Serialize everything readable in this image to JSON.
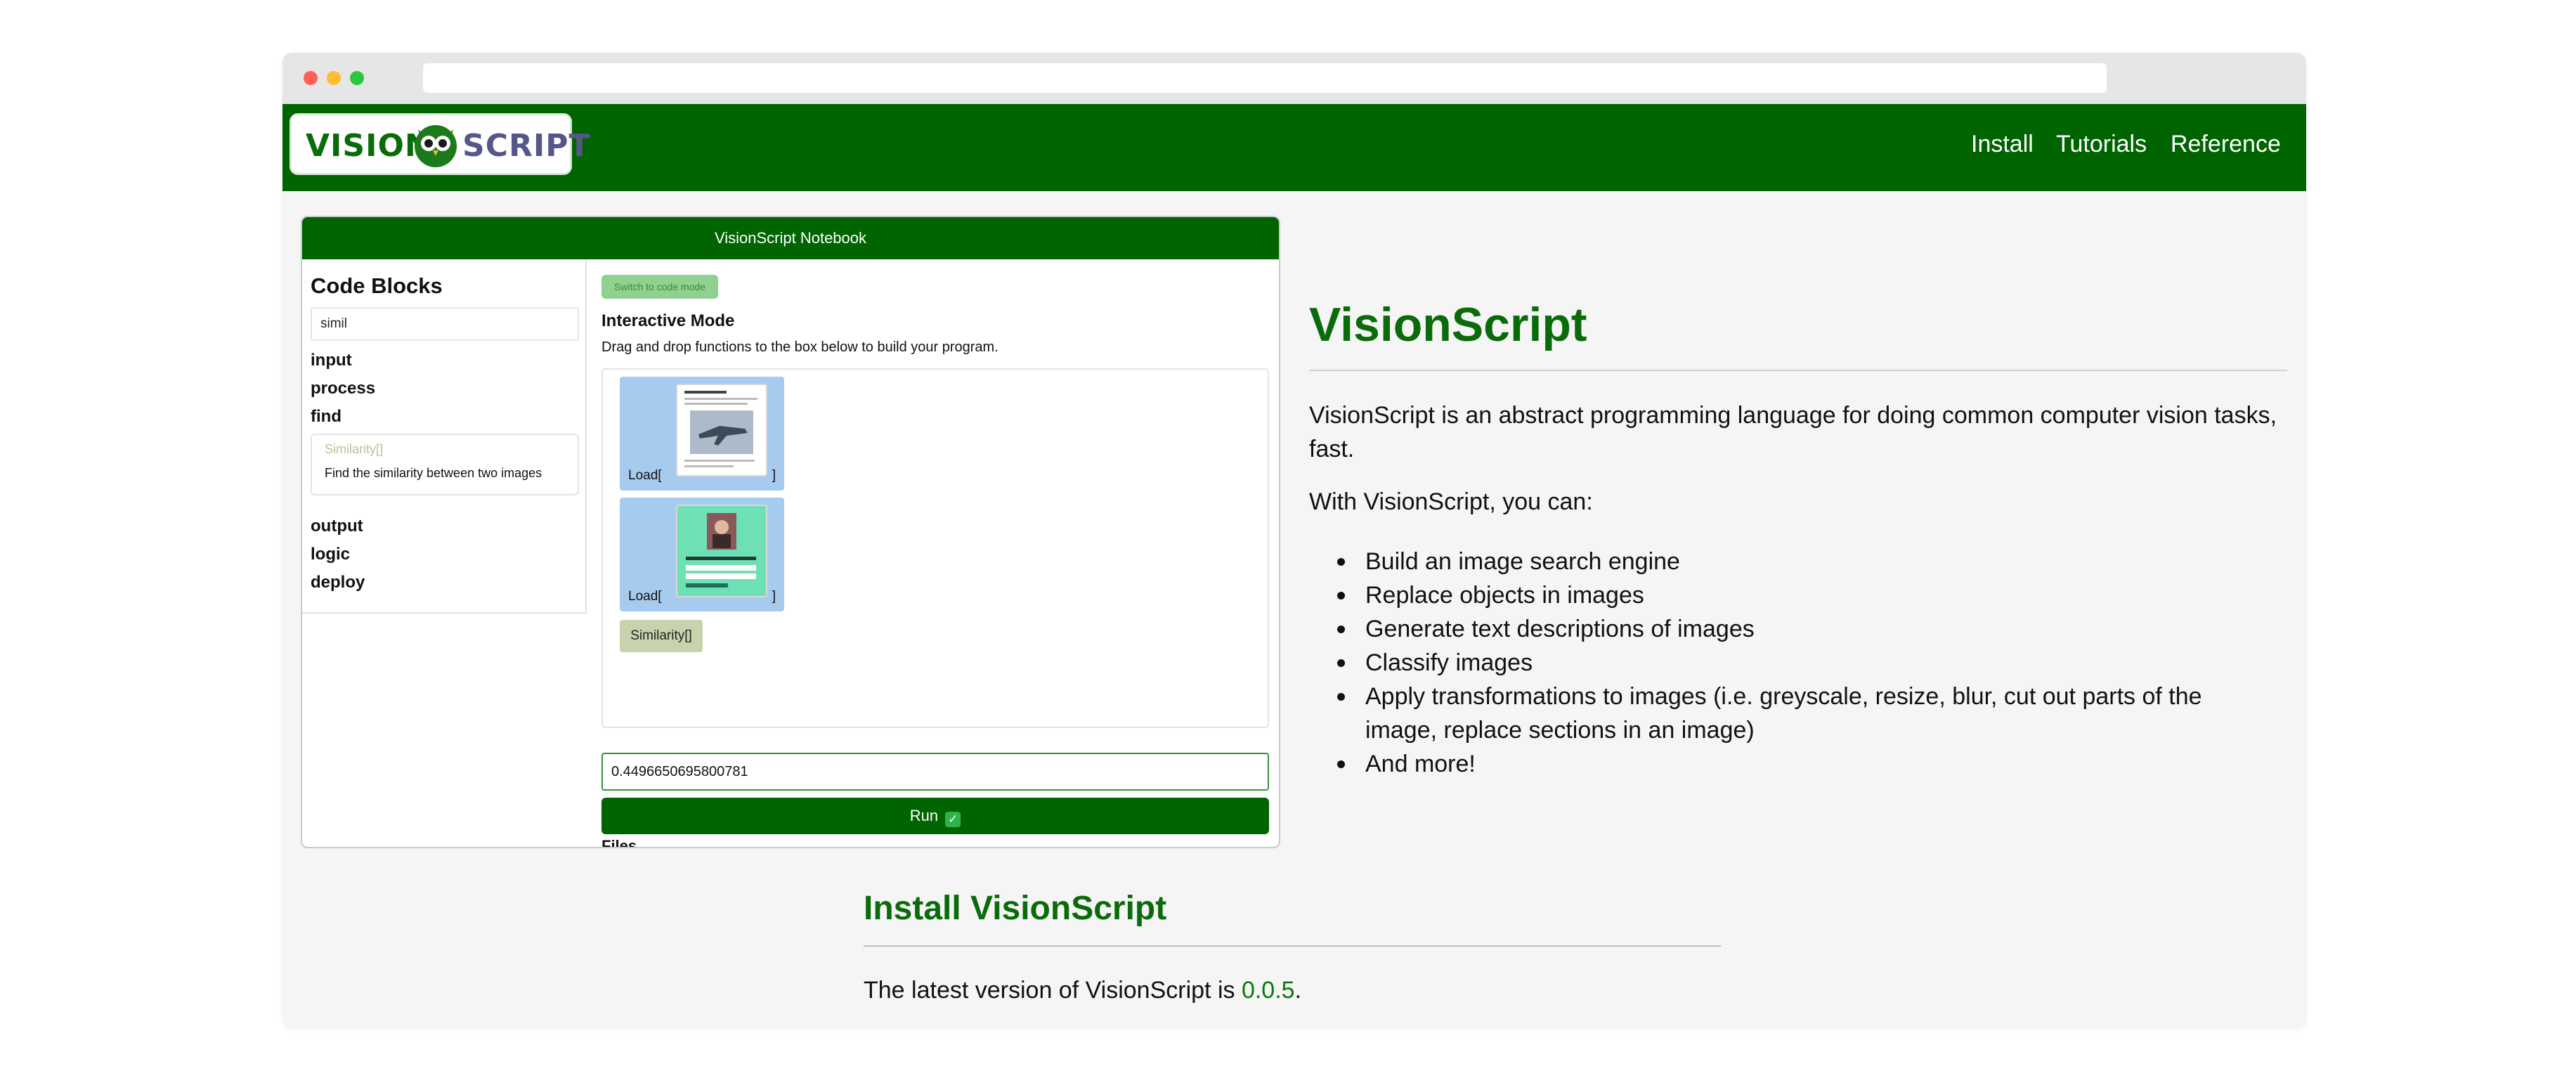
{
  "browser": {
    "url": ""
  },
  "header": {
    "logo_left": "VISION",
    "logo_right": "SCRIPT",
    "nav": [
      "Install",
      "Tutorials",
      "Reference"
    ]
  },
  "notebook": {
    "title": "VisionScript Notebook",
    "sidebar": {
      "heading": "Code Blocks",
      "search_value": "simil",
      "categories": [
        "input",
        "process",
        "find",
        "output",
        "logic",
        "deploy"
      ],
      "result_name": "Similarity[]",
      "result_desc": "Find the similarity between two images"
    },
    "main": {
      "switch_label": "Switch to code mode",
      "mode_title": "Interactive Mode",
      "mode_desc": "Drag and drop functions to the box below to build your program.",
      "blocks": [
        {
          "label": "Load[",
          "close": "]"
        },
        {
          "label": "Load[",
          "close": "]"
        },
        {
          "label": "Similarity[]"
        }
      ],
      "output_value": "0.4496650695800781",
      "run_label": "Run",
      "files_label": "Files"
    }
  },
  "content": {
    "title": "VisionScript",
    "intro": "VisionScript is an abstract programming language for doing common computer vision tasks, fast.",
    "with_text": "With VisionScript, you can:",
    "features": [
      "Build an image search engine",
      "Replace objects in images",
      "Generate text descriptions of images",
      "Classify images",
      "Apply transformations to images (i.e. greyscale, resize, blur, cut out parts of the image, replace sections in an image)",
      "And more!"
    ],
    "install_title": "Install VisionScript",
    "latest_prefix": "The latest version of VisionScript is ",
    "latest_version": "0.0.5",
    "latest_suffix": "."
  },
  "colors": {
    "brand_green": "#006400",
    "heading_green": "#0a6b0a",
    "load_block": "#a7cbef",
    "similarity_block": "#c6d3ad"
  },
  "icons": [
    "owl-logo-icon",
    "check-icon"
  ]
}
